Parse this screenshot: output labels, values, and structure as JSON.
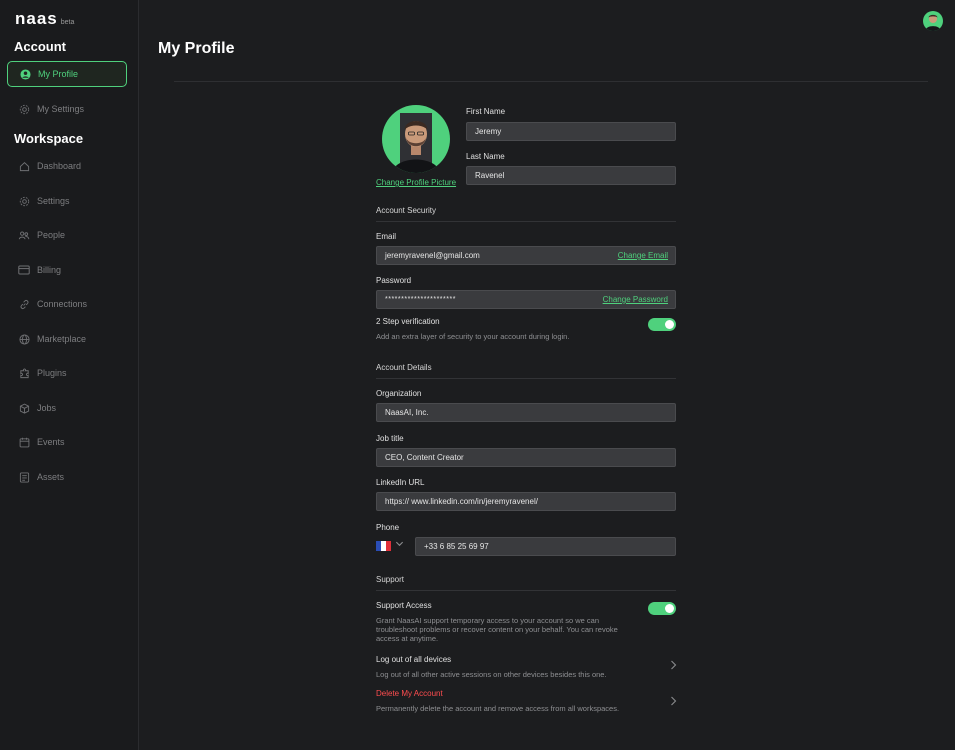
{
  "app": {
    "logo": "naas",
    "logo_tag": "beta"
  },
  "sidebar": {
    "account_title": "Account",
    "account_items": [
      {
        "label": "My Profile",
        "icon": "user-circle-icon",
        "active": true
      },
      {
        "label": "My Settings",
        "icon": "gear-icon"
      }
    ],
    "workspace_title": "Workspace",
    "workspace_items": [
      {
        "label": "Dashboard",
        "icon": "home-icon"
      },
      {
        "label": "Settings",
        "icon": "gear-icon"
      },
      {
        "label": "People",
        "icon": "people-icon"
      },
      {
        "label": "Billing",
        "icon": "card-icon"
      },
      {
        "label": "Connections",
        "icon": "link-icon"
      },
      {
        "label": "Marketplace",
        "icon": "globe-icon"
      },
      {
        "label": "Plugins",
        "icon": "puzzle-icon"
      },
      {
        "label": "Jobs",
        "icon": "box-icon"
      },
      {
        "label": "Events",
        "icon": "calendar-icon"
      },
      {
        "label": "Assets",
        "icon": "file-icon"
      }
    ]
  },
  "page": {
    "title": "My Profile"
  },
  "profile": {
    "change_picture": "Change Profile Picture",
    "first_name_label": "First Name",
    "first_name": "Jeremy",
    "last_name_label": "Last Name",
    "last_name": "Ravenel"
  },
  "security": {
    "title": "Account Security",
    "email_label": "Email",
    "email": "jeremyravenel@gmail.com",
    "change_email": "Change Email",
    "password_label": "Password",
    "password": "**********************",
    "change_password": "Change Password",
    "two_step_label": "2 Step verification",
    "two_step_desc": "Add an extra layer of security to your account during login."
  },
  "details": {
    "title": "Account Details",
    "org_label": "Organization",
    "org": "NaasAI, Inc.",
    "job_label": "Job title",
    "job": "CEO, Content Creator",
    "linkedin_label": "LinkedIn URL",
    "linkedin": "https:// www.linkedin.com/in/jeremyravenel/",
    "phone_label": "Phone",
    "phone": "+33 6 85 25 69 97"
  },
  "support": {
    "title": "Support",
    "access_label": "Support Access",
    "access_desc": "Grant NaasAI support temporary access to your account so we can troubleshoot problems or recover content on your behalf. You can revoke access at anytime.",
    "logout_label": "Log out of all devices",
    "logout_desc": "Log out of all other active sessions on other devices besides this one.",
    "delete_label": "Delete My Account",
    "delete_desc": "Permanently delete the account and remove access from all workspaces."
  },
  "colors": {
    "accent": "#4fd17d",
    "danger": "#ff4d4f",
    "bg": "#1c1d1f"
  }
}
